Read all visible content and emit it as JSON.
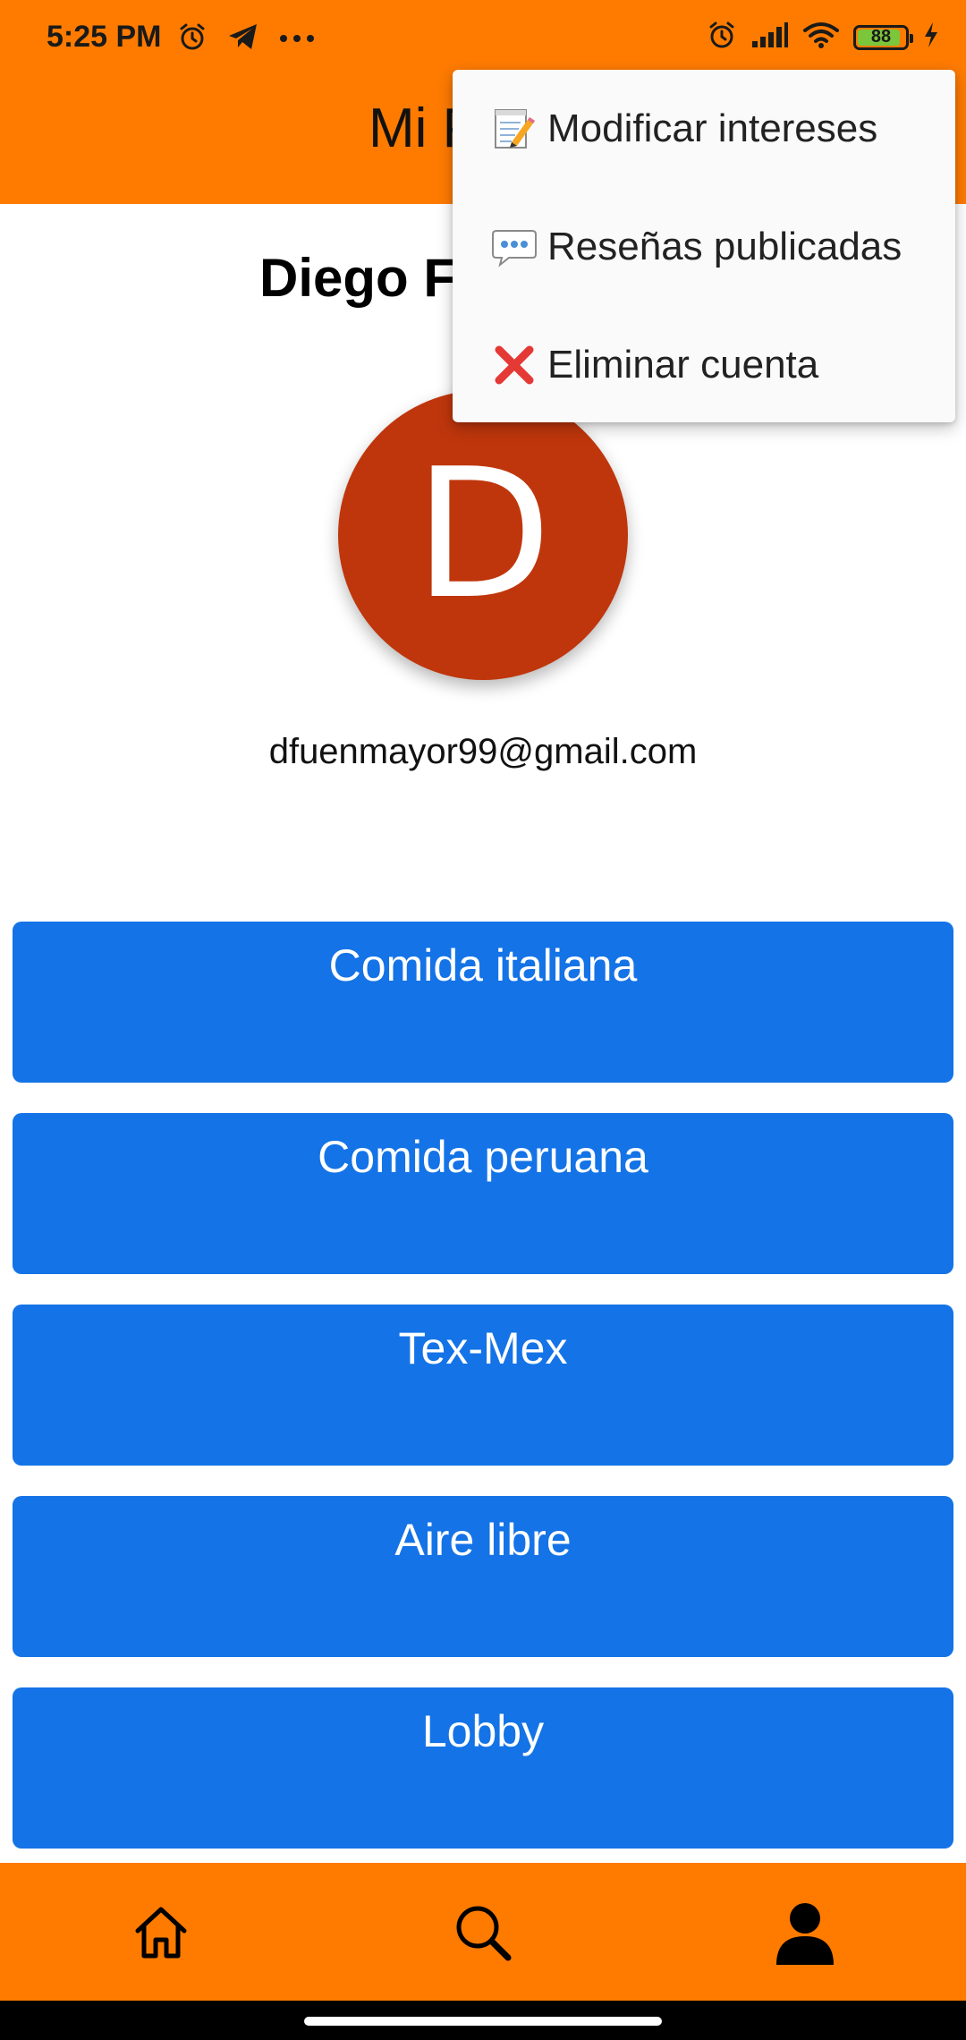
{
  "status_bar": {
    "time": "5:25 PM",
    "battery_level": "88",
    "icons": [
      "alarm-icon",
      "telegram-icon",
      "more-dots-icon",
      "alarm-icon",
      "signal-icon",
      "wifi-icon",
      "battery-icon",
      "charging-icon"
    ]
  },
  "app_bar": {
    "title": "Mi P"
  },
  "profile": {
    "name": "Diego F",
    "avatar_letter": "D",
    "avatar_color": "#BF360C",
    "email": "dfuenmayor99@gmail.com"
  },
  "interests": [
    {
      "label": "Comida italiana"
    },
    {
      "label": "Comida peruana"
    },
    {
      "label": "Tex-Mex"
    },
    {
      "label": "Aire libre"
    },
    {
      "label": "Lobby"
    }
  ],
  "menu": {
    "items": [
      {
        "icon": "memo-icon",
        "label": "Modificar intereses"
      },
      {
        "icon": "speech-bubble-icon",
        "label": "Reseñas publicadas"
      },
      {
        "icon": "cross-mark-icon",
        "label": "Eliminar cuenta"
      }
    ]
  },
  "bottom_nav": {
    "items": [
      {
        "icon": "home-icon"
      },
      {
        "icon": "search-icon"
      },
      {
        "icon": "profile-icon"
      }
    ]
  },
  "colors": {
    "primary": "#FF7B00",
    "button": "#1473E6",
    "menu_background": "#FAFAFA"
  }
}
